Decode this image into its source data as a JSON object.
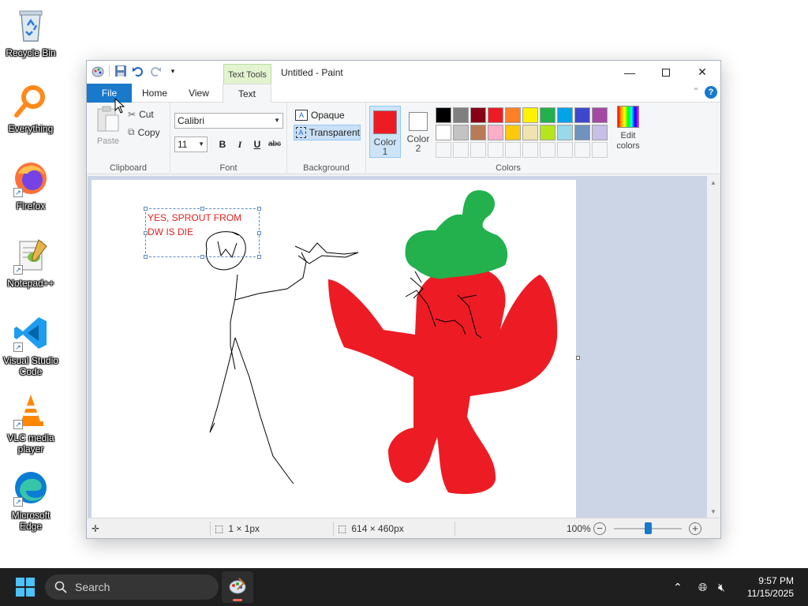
{
  "desktop": {
    "icons": [
      {
        "label": "Recycle Bin"
      },
      {
        "label": "Everything"
      },
      {
        "label": "Firefox"
      },
      {
        "label": "Notepad++"
      },
      {
        "label": "Visual Studio Code"
      },
      {
        "label": "VLC media player"
      },
      {
        "label": "Microsoft Edge"
      }
    ]
  },
  "window": {
    "title": "Untitled - Paint",
    "context_tab": "Text Tools"
  },
  "tabs": {
    "file": "File",
    "home": "Home",
    "view": "View",
    "text": "Text"
  },
  "ribbon": {
    "clipboard": {
      "paste": "Paste",
      "cut": "Cut",
      "copy": "Copy",
      "label": "Clipboard"
    },
    "font": {
      "family": "Calibri",
      "size": "11",
      "bold": "B",
      "italic": "I",
      "underline": "U",
      "strike": "abc",
      "label": "Font"
    },
    "background": {
      "opaque": "Opaque",
      "transparent": "Transparent",
      "label": "Background"
    },
    "colors": {
      "color1": "Color",
      "color1_num": "1",
      "color2": "Color",
      "color2_num": "2",
      "color1_value": "#ed1c24",
      "color2_value": "#ffffff",
      "edit": "Edit colors",
      "label": "Colors",
      "palette_row1": [
        "#000000",
        "#7f7f7f",
        "#880015",
        "#ed1c24",
        "#ff7f27",
        "#fff200",
        "#22b14c",
        "#00a2e8",
        "#3f48cc",
        "#a349a4"
      ],
      "palette_row2": [
        "#ffffff",
        "#c3c3c3",
        "#b97a57",
        "#ffaec9",
        "#ffc90e",
        "#efe4b0",
        "#b5e61d",
        "#99d9ea",
        "#7092be",
        "#c8bfe7"
      ]
    }
  },
  "canvas": {
    "text": [
      "YES, SPROUT FROM",
      "DW IS DIE"
    ]
  },
  "status": {
    "selection": "1 × 1px",
    "size": "614 × 460px",
    "zoom": "100%"
  },
  "taskbar": {
    "search": "Search",
    "time": "9:57 PM",
    "date": "11/15/2025"
  }
}
